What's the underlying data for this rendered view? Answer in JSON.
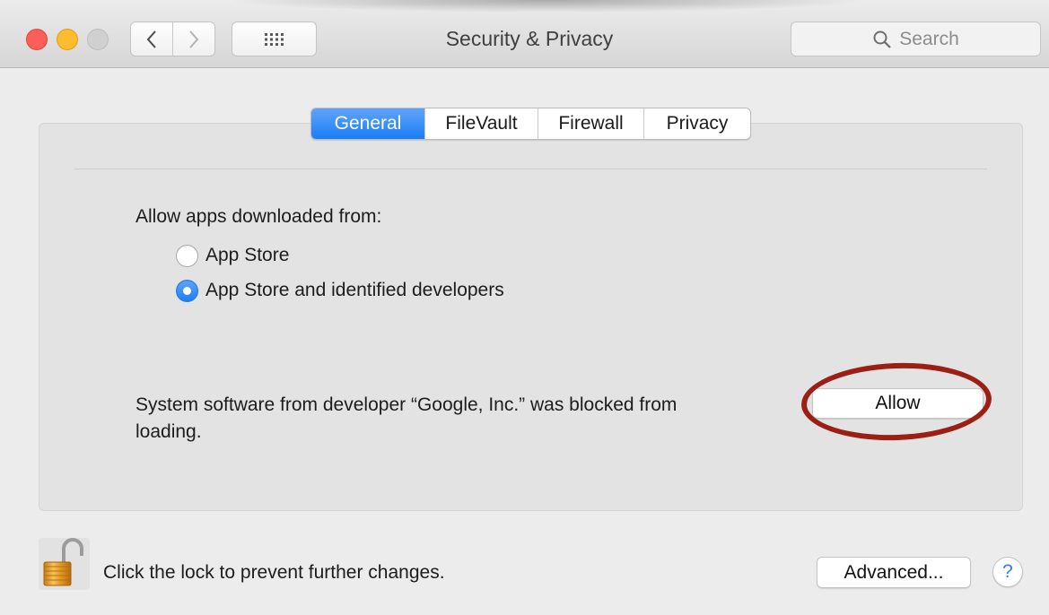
{
  "window": {
    "title": "Security & Privacy"
  },
  "toolbar": {
    "back_icon": "chevron-left-icon",
    "forward_icon": "chevron-right-icon",
    "show_all_icon": "grid-icon",
    "search_placeholder": "Search",
    "search_icon": "search-icon"
  },
  "tabs": [
    {
      "label": "General",
      "active": true
    },
    {
      "label": "FileVault",
      "active": false
    },
    {
      "label": "Firewall",
      "active": false
    },
    {
      "label": "Privacy",
      "active": false
    }
  ],
  "general": {
    "allow_heading": "Allow apps downloaded from:",
    "options": [
      {
        "label": "App Store",
        "selected": false
      },
      {
        "label": "App Store and identified developers",
        "selected": true
      }
    ],
    "blocked_message": "System software from developer “Google, Inc.” was blocked from loading.",
    "allow_button": "Allow"
  },
  "footer": {
    "lock_text": "Click the lock to prevent further changes.",
    "lock_icon": "unlocked-padlock-icon",
    "advanced_button": "Advanced...",
    "help_button": "?"
  },
  "colors": {
    "accent_blue": "#1a7ef5",
    "close_red": "#fc5f57",
    "minimize_yellow": "#fdbc2e",
    "annotation_red": "#9c1f15"
  }
}
